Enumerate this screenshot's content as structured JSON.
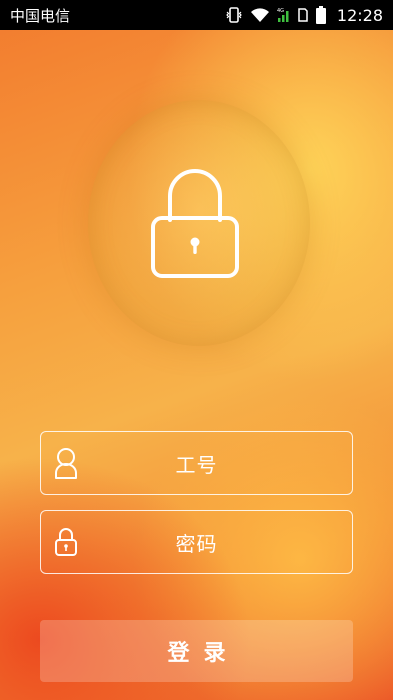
{
  "status_bar": {
    "carrier": "中国电信",
    "time": "12:28",
    "icons": [
      "vibrate-icon",
      "wifi-icon",
      "signal-icon",
      "sim-icon",
      "battery-icon"
    ]
  },
  "lock": {
    "icon": "lock-icon"
  },
  "form": {
    "username_label": "工号",
    "password_label": "密码",
    "username_icon": "user-icon",
    "password_icon": "lock-icon"
  },
  "login_button": {
    "label": "登录"
  },
  "colors": {
    "gradient_top": "#f7b24a",
    "gradient_bottom": "#ec5a28",
    "text": "#ffffff"
  }
}
